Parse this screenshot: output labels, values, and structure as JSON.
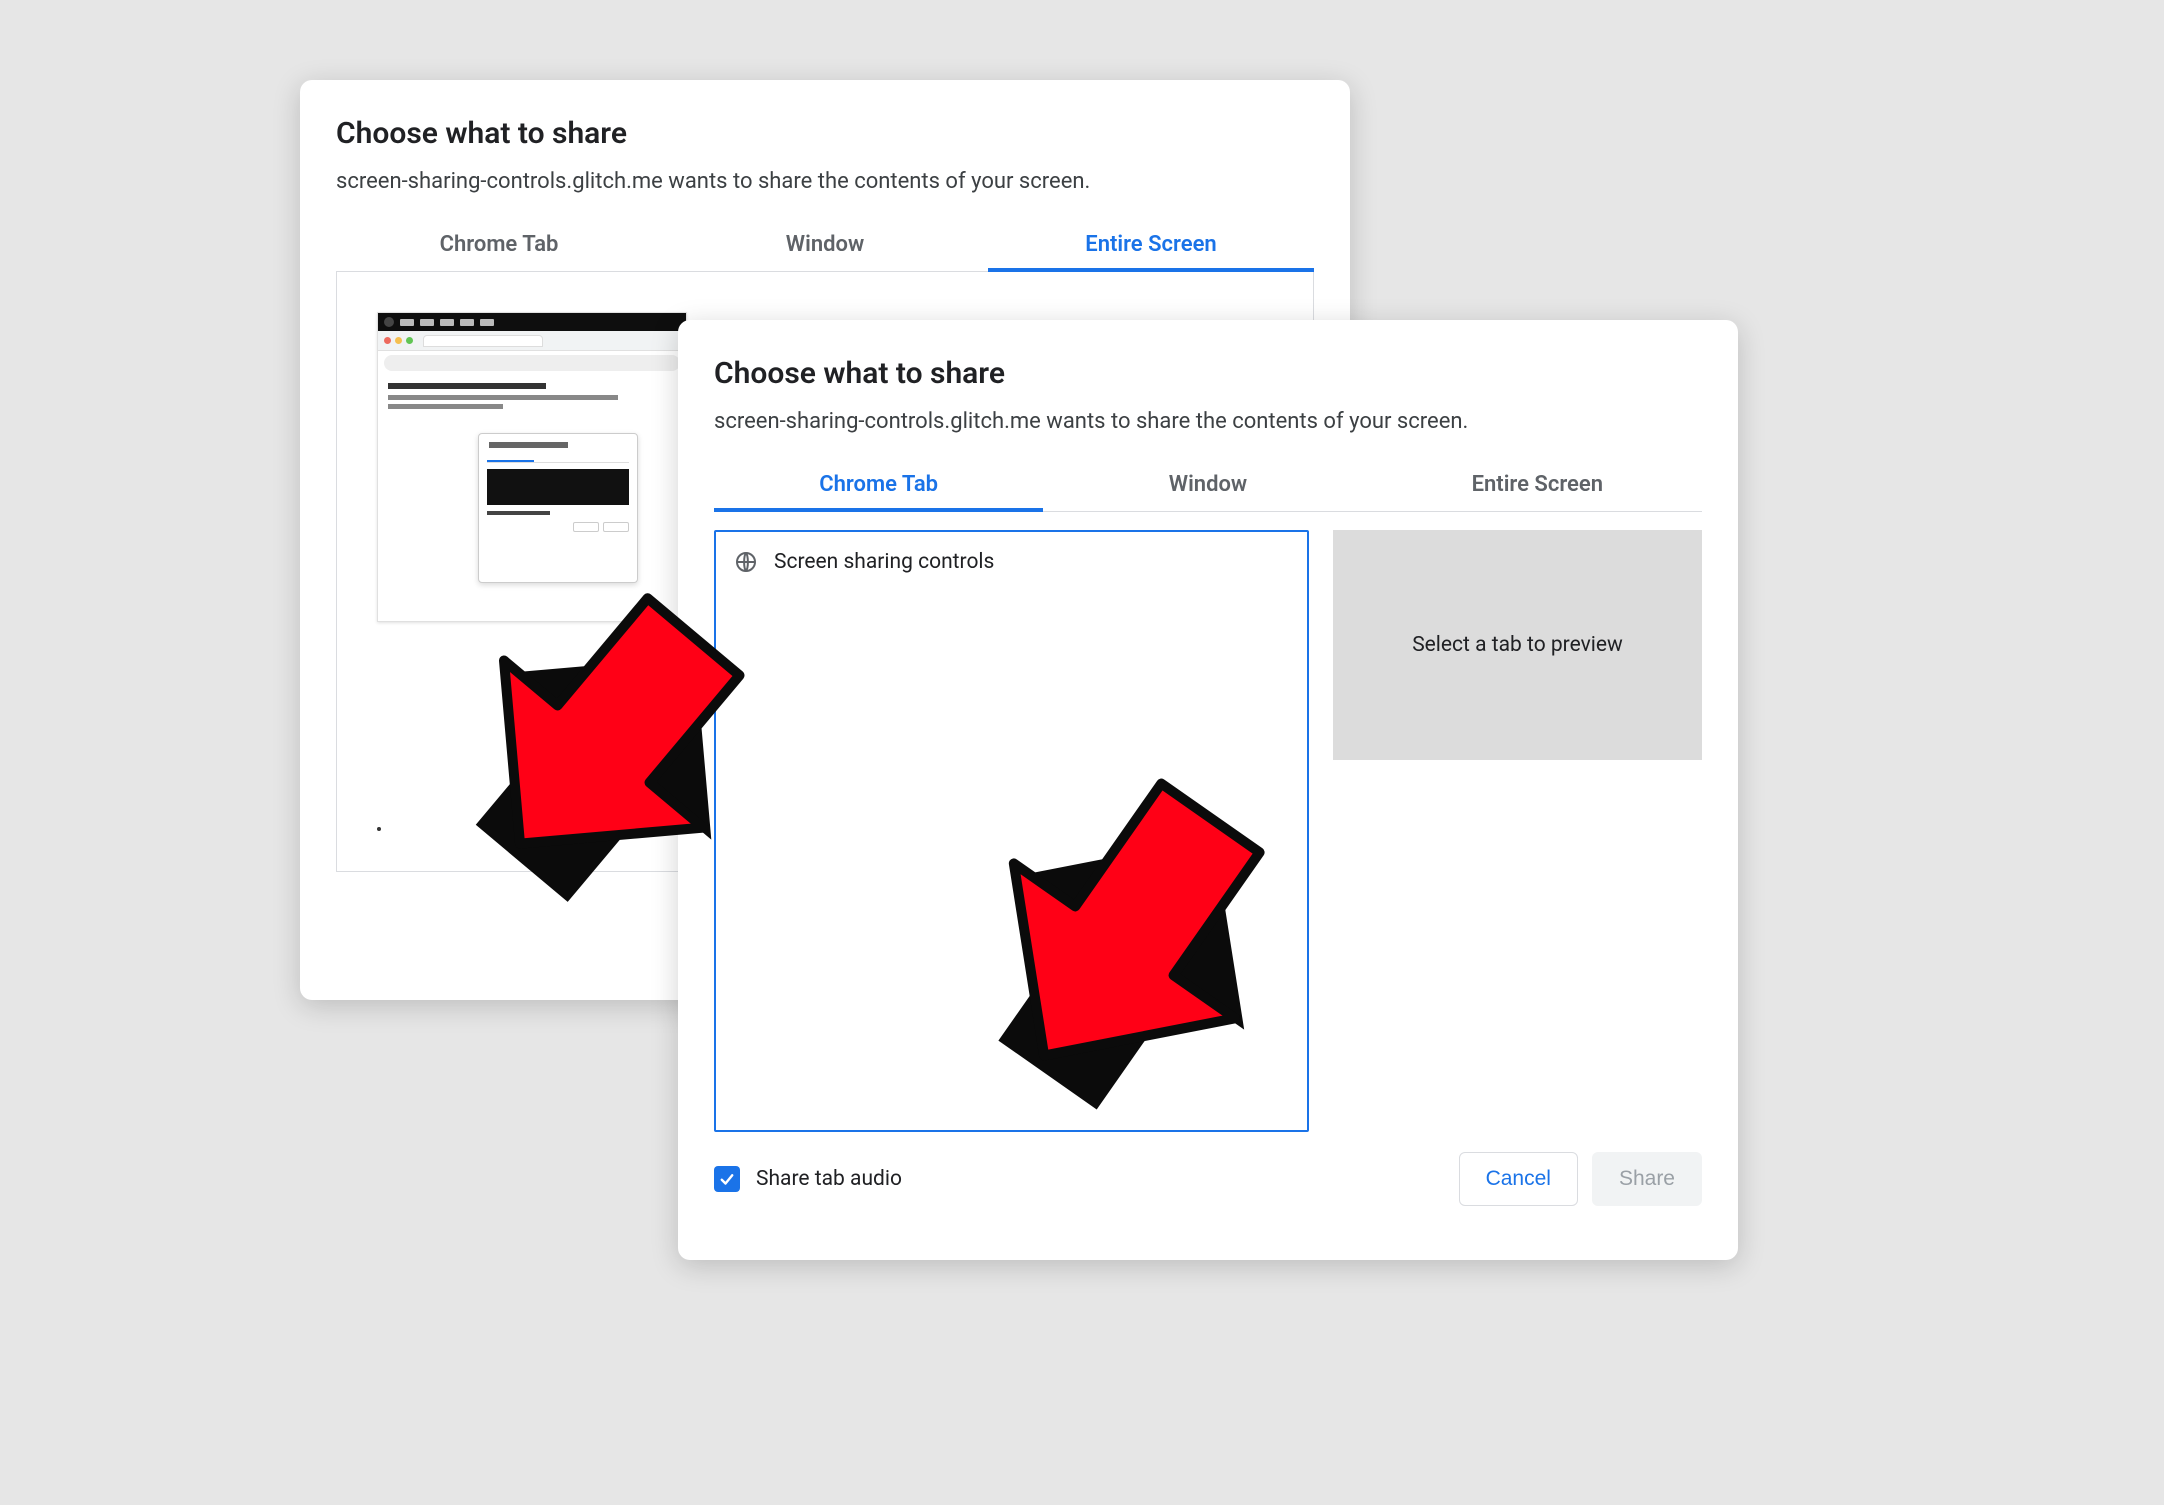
{
  "dialog1": {
    "title": "Choose what to share",
    "subtitle": "screen-sharing-controls.glitch.me wants to share the contents of your screen.",
    "tabs": [
      "Chrome Tab",
      "Window",
      "Entire Screen"
    ],
    "active_tab_index": 2
  },
  "dialog2": {
    "title": "Choose what to share",
    "subtitle": "screen-sharing-controls.glitch.me wants to share the contents of your screen.",
    "tabs": [
      "Chrome Tab",
      "Window",
      "Entire Screen"
    ],
    "active_tab_index": 0,
    "tab_list": [
      {
        "icon": "globe-icon",
        "label": "Screen sharing controls"
      }
    ],
    "preview_placeholder": "Select a tab to preview",
    "share_audio_label": "Share tab audio",
    "share_audio_checked": true,
    "cancel_label": "Cancel",
    "share_label": "Share"
  },
  "colors": {
    "accent": "#1a73e8",
    "annotation": "#ff0016"
  }
}
